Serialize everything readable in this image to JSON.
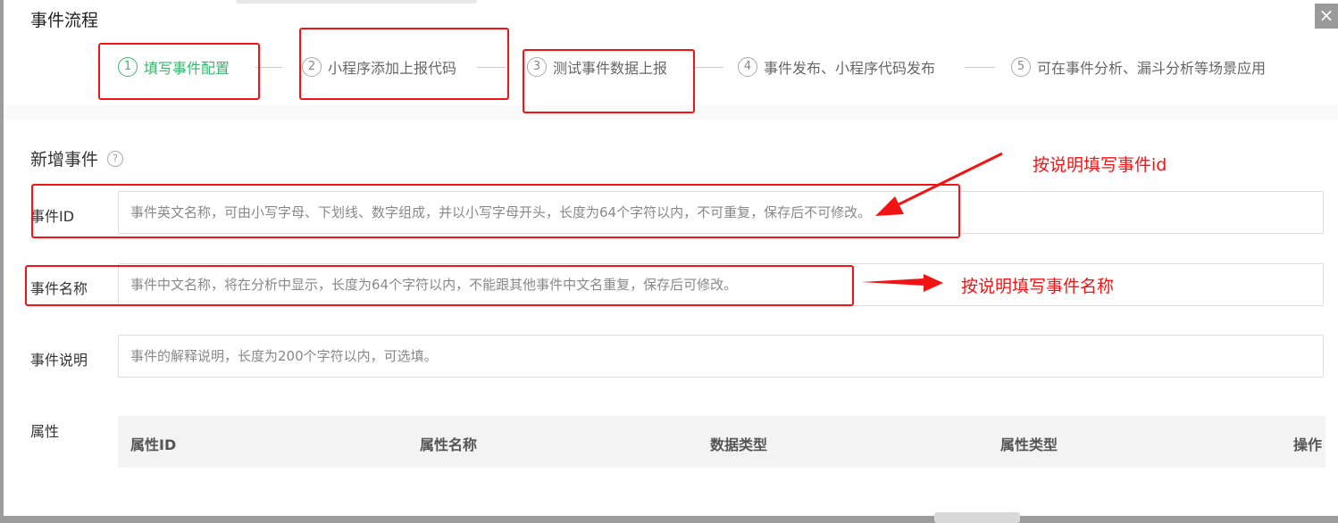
{
  "dialog": {
    "title": "事件流程",
    "close_icon": "×"
  },
  "steps": [
    {
      "num": "1",
      "label": "填写事件配置",
      "active": true
    },
    {
      "num": "2",
      "label": "小程序添加上报代码",
      "active": false
    },
    {
      "num": "3",
      "label": "测试事件数据上报",
      "active": false
    },
    {
      "num": "4",
      "label": "事件发布、小程序代码发布",
      "active": false
    },
    {
      "num": "5",
      "label": "可在事件分析、漏斗分析等场景应用",
      "active": false
    }
  ],
  "form": {
    "section_title": "新增事件",
    "help_icon": "?",
    "event_id": {
      "label": "事件ID",
      "placeholder": "事件英文名称，可由小写字母、下划线、数字组成，并以小写字母开头，长度为64个字符以内，不可重复，保存后不可修改。"
    },
    "event_name": {
      "label": "事件名称",
      "placeholder": "事件中文名称，将在分析中显示，长度为64个字符以内，不能跟其他事件中文名重复，保存后可修改。"
    },
    "event_desc": {
      "label": "事件说明",
      "placeholder": "事件的解释说明，长度为200个字符以内，可选填。"
    },
    "properties": {
      "label": "属性",
      "columns": [
        "属性ID",
        "属性名称",
        "数据类型",
        "属性类型",
        "操作"
      ]
    }
  },
  "annotations": {
    "id_note": "按说明填写事件id",
    "name_note": "按说明填写事件名称",
    "color": "#f21414"
  },
  "colors": {
    "active_step": "#3cb371",
    "overlay": "#9c9c9c"
  }
}
